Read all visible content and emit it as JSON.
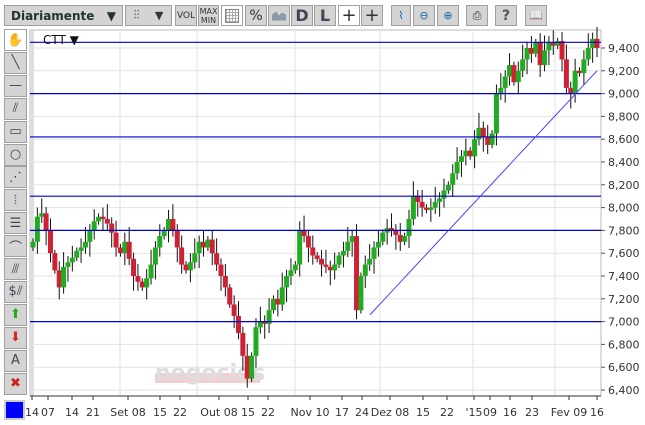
{
  "toolbar": {
    "period_select": "Diariamente",
    "vol_label": "VOL",
    "maxmin_label": "MAX\nMIN",
    "max_label": "MAX",
    "min_label": "MIN",
    "percent_label": "%",
    "d_label": "D",
    "l_label": "L",
    "help_label": "?"
  },
  "left_tools": [
    "hand-tool",
    "line-tool",
    "horizontal-line-tool",
    "parallel-line-tool",
    "rectangle-tool",
    "circle-tool",
    "fan-tool",
    "vertical-grid-tool",
    "horizontal-grid-tool",
    "arc-tool",
    "channel-tool",
    "s-channel-tool",
    "buy-arrow-tool",
    "sell-arrow-tool",
    "text-tool",
    "delete-tool"
  ],
  "text_tool_label": "A",
  "s_label": "$",
  "color_swatch": "#0000ff",
  "chart_data": {
    "type": "candlestick",
    "symbol": "CTT ▼",
    "ylim": [
      6400,
      9500
    ],
    "y_ticks": [
      "9,400",
      "9,200",
      "9,000",
      "8,800",
      "8,600",
      "8,400",
      "8,200",
      "8,000",
      "7,800",
      "7,600",
      "7,400",
      "7,200",
      "7,000",
      "6,800",
      "6,600",
      "6,400"
    ],
    "x_labels": [
      "14",
      "07",
      "14",
      "21",
      "Set 08",
      "15",
      "22",
      "Out 08",
      "15",
      "22",
      "Nov 10",
      "17",
      "24",
      "Dez 08",
      "15",
      "22",
      "'15",
      "09",
      "16",
      "23",
      "Fev 09",
      "16"
    ],
    "closes": [
      7700,
      7920,
      7950,
      7800,
      7600,
      7450,
      7300,
      7480,
      7520,
      7560,
      7620,
      7650,
      7700,
      7800,
      7880,
      7920,
      7900,
      7860,
      7780,
      7650,
      7600,
      7700,
      7550,
      7400,
      7350,
      7300,
      7380,
      7500,
      7650,
      7750,
      7800,
      7900,
      7800,
      7650,
      7500,
      7450,
      7520,
      7600,
      7700,
      7650,
      7720,
      7600,
      7500,
      7400,
      7300,
      7150,
      7050,
      6900,
      6700,
      6500,
      6700,
      6950,
      7000,
      6980,
      7100,
      7200,
      7150,
      7300,
      7400,
      7450,
      7500,
      7800,
      7750,
      7650,
      7580,
      7550,
      7500,
      7480,
      7450,
      7500,
      7580,
      7620,
      7700,
      7750,
      7100,
      7400,
      7500,
      7550,
      7650,
      7700,
      7780,
      7820,
      7800,
      7760,
      7700,
      7750,
      7900,
      8100,
      8050,
      8000,
      7980,
      8000,
      8050,
      8080,
      8150,
      8200,
      8300,
      8400,
      8450,
      8500,
      8450,
      8600,
      8700,
      8620,
      8550,
      8650,
      9000,
      9050,
      9150,
      9250,
      9100,
      9200,
      9300,
      9400,
      9350,
      9450,
      9250,
      9380,
      9450,
      9420,
      9460,
      9300,
      9050,
      9000,
      9200,
      9180,
      9300,
      9400,
      9480,
      9400
    ],
    "horizontal_lines": [
      9450,
      9000,
      8620,
      8100,
      7800,
      7000
    ],
    "trendline": {
      "from": [
        7060,
        "Dez 01"
      ],
      "to": [
        9200,
        "Fev 16"
      ]
    },
    "colors": {
      "up": "#22aa22",
      "down": "#cc2233",
      "lines": "#0000cc",
      "trend": "#4444ff"
    }
  },
  "watermark": "negocios"
}
